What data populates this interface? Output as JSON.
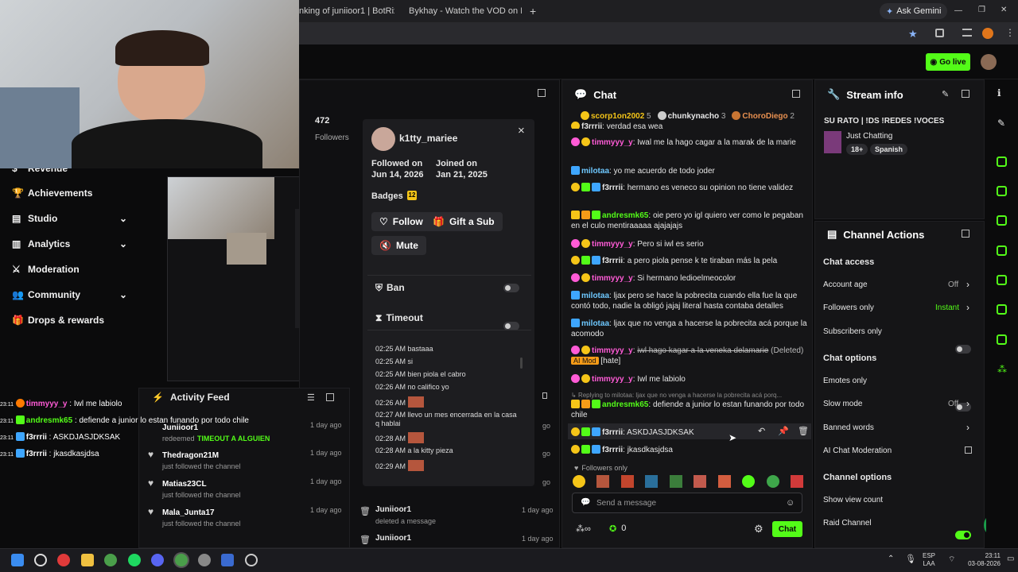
{
  "browser": {
    "tabs": [
      {
        "label": "nking of juniioor1 | BotRix—"
      },
      {
        "label": "Bykhay - Watch the VOD on Ki"
      }
    ],
    "plus": "+",
    "ask_gemini": "Ask Gemini",
    "win_min": "—",
    "win_max": "❐",
    "win_close": "✕"
  },
  "header": {
    "go_live": "Go live"
  },
  "left_nav": {
    "items": [
      {
        "label": "Revenue"
      },
      {
        "label": "Achievements"
      },
      {
        "label": "Studio"
      },
      {
        "label": "Analytics"
      },
      {
        "label": "Moderation"
      },
      {
        "label": "Community"
      },
      {
        "label": "Drops & rewards"
      }
    ]
  },
  "stats": {
    "followers_count": "472",
    "followers_label": "Followers"
  },
  "user_card": {
    "username": "k1tty_mariee",
    "followed_on_label": "Followed on",
    "followed_on": "Jun 14, 2026",
    "joined_on_label": "Joined on",
    "joined_on": "Jan 21, 2025",
    "badges_label": "Badges",
    "badges_count": "12",
    "follow": "Follow",
    "gift": "Gift a Sub",
    "mute": "Mute",
    "ban": "Ban",
    "timeout": "Timeout",
    "close": "×",
    "messages": [
      {
        "time": "02:25 AM",
        "text": "bastaaa"
      },
      {
        "time": "02:25 AM",
        "text": "si"
      },
      {
        "time": "02:25 AM",
        "text": "bien piola el cabro"
      },
      {
        "time": "02:26 AM",
        "text": "no califico yo"
      },
      {
        "time": "02:26 AM",
        "text": ""
      },
      {
        "time": "02:27 AM",
        "text": "llevo un mes encerrada en la casa q hablai"
      },
      {
        "time": "02:28 AM",
        "text": ""
      },
      {
        "time": "02:28 AM",
        "text": "a la kitty pieza"
      },
      {
        "time": "02:29 AM",
        "text": ""
      }
    ]
  },
  "activity_feed": {
    "title": "Activity Feed",
    "rows": [
      {
        "name": "Juniioor1",
        "sub": "redeemed",
        "reward": "TIMEOUT A ALGUIEN",
        "ago": "1 day ago"
      },
      {
        "name": "Thedragon21M",
        "sub": "just followed the channel",
        "ago": "1 day ago"
      },
      {
        "name": "Matias23CL",
        "sub": "just followed the channel",
        "ago": "1 day ago"
      },
      {
        "name": "Mala_Junta17",
        "sub": "just followed the channel",
        "ago": "1 day ago"
      }
    ],
    "right_rows": [
      {
        "name": "Juniioor1",
        "sub": "deleted a message",
        "ago": "1 day ago"
      },
      {
        "name": "Juniioor1",
        "sub": "",
        "ago": "1 day ago"
      }
    ],
    "go1": "go",
    "go2": "go",
    "go3": "go"
  },
  "overlay_chat": [
    {
      "time": "23:11",
      "user": "timmyyy_y",
      "text": "Iwl me labiolo",
      "color": "#ff5bd6"
    },
    {
      "time": "23:11",
      "user": "andresmk65",
      "text": "defiende a junior lo estan funando por todo chile",
      "color": "#53fc18"
    },
    {
      "time": "23:11",
      "user": "f3rrrii",
      "text": "ASKDJASJDKSAK",
      "color": "#ffffff"
    },
    {
      "time": "23:11",
      "user": "f3rrrii",
      "text": "jkasdkasjdsa",
      "color": "#ffffff"
    }
  ],
  "chat": {
    "title": "Chat",
    "top_gifters": [
      {
        "name": "scorp1on2002",
        "count": "5"
      },
      {
        "name": "chunkynacho",
        "count": "3"
      },
      {
        "name": "ChoroDiego",
        "count": "2"
      }
    ],
    "messages": [
      {
        "user": "f3rrrii",
        "text": "verdad esa wea"
      },
      {
        "user": "timmyyy_y",
        "text": "Iwal me la hago cagar a la marak de la marie"
      },
      {
        "user": "milotaa",
        "text": "yo me acuerdo de todo joder"
      },
      {
        "user": "f3rrrii",
        "text": "hermano es veneco su opinion no tiene validez"
      },
      {
        "user": "andresmk65",
        "text": "oie pero yo igl quiero ver como le pegaban en el culo mentiraaaaa ajajajajs"
      },
      {
        "user": "timmyyy_y",
        "text": "Pero si iwl es serio"
      },
      {
        "user": "f3rrrii",
        "text": "a pero piola pense k te tiraban más la pela"
      },
      {
        "user": "timmyyy_y",
        "text": "Si hermano ledioelmeocolor"
      },
      {
        "user": "milotaa",
        "text": "ljax pero se hace la pobrecita cuando ella fue la que contó todo, nadie la obligó jajaj literal hasta contaba detalles"
      },
      {
        "user": "milotaa",
        "text": "ljax que no venga a hacerse la pobrecita acá porque la acomodo"
      },
      {
        "user": "timmyyy_y",
        "text": "iwl hago kagar a la veneka delamarie",
        "deleted": "(Deleted)",
        "mod": "AI Mod",
        "tag": "[hate]"
      },
      {
        "user": "timmyyy_y",
        "text": "Iwl me labiolo"
      },
      {
        "reply": "Replying to milotaa: ljax que no venga a hacerse la pobrecita acá porq..."
      },
      {
        "user": "andresmk65",
        "text": "defiende a junior lo estan funando por todo chile"
      },
      {
        "user": "f3rrrii",
        "text": "ASKDJASJDKSAK"
      },
      {
        "user": "f3rrrii",
        "text": "jkasdkasjdsa"
      }
    ],
    "followers_only": "Followers only",
    "placeholder": "Send a message",
    "points": "0",
    "send": "Chat"
  },
  "stream_info": {
    "title": "Stream info",
    "stream_title": "SU RATO | !DS !REDES !VOCES",
    "category": "Just Chatting",
    "tags": [
      "18+",
      "Spanish"
    ]
  },
  "channel_actions": {
    "title": "Channel Actions",
    "chat_access": "Chat access",
    "account_age": "Account age",
    "account_age_value": "Off",
    "followers_only": "Followers only",
    "followers_only_value": "Instant",
    "subscribers_only": "Subscribers only",
    "chat_options": "Chat options",
    "emotes_only": "Emotes only",
    "slow_mode": "Slow mode",
    "slow_mode_value": "Off",
    "banned_words": "Banned words",
    "ai_moderation": "AI Chat Moderation",
    "channel_options": "Channel options",
    "show_view_count": "Show view count",
    "raid_channel": "Raid Channel",
    "badge_count": "1"
  },
  "taskbar": {
    "lang1": "ESP",
    "lang2": "LAA",
    "time": "23:11",
    "date": "03-08-2026"
  }
}
